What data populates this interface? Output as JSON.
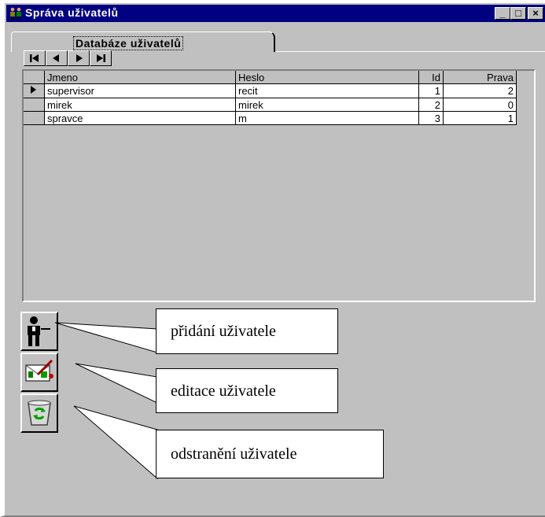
{
  "window": {
    "title": "Správa uživatelů",
    "controls": {
      "minimize": "_",
      "maximize": "□",
      "close": "×"
    }
  },
  "tab": {
    "label": "Databáze uživatelů"
  },
  "navigator": {
    "buttons": [
      "first-record-icon",
      "prior-record-icon",
      "next-record-icon",
      "last-record-icon"
    ]
  },
  "grid": {
    "columns": [
      "Jmeno",
      "Heslo",
      "Id",
      "Prava"
    ],
    "rows": [
      {
        "jmeno": "supervisor",
        "heslo": "recit",
        "id": "1",
        "prava": "2",
        "current": true
      },
      {
        "jmeno": "mirek",
        "heslo": "mirek",
        "id": "2",
        "prava": "0",
        "current": false
      },
      {
        "jmeno": "spravce",
        "heslo": "m",
        "id": "3",
        "prava": "1",
        "current": false
      }
    ]
  },
  "actions": {
    "add": {
      "icon": "add-user-icon",
      "callout": "přidání uživatele"
    },
    "edit": {
      "icon": "edit-user-icon",
      "callout": "editace uživatele"
    },
    "delete": {
      "icon": "recycle-bin-icon",
      "callout": "odstranění uživatele"
    }
  },
  "colors": {
    "titlebar": "#000080",
    "face": "#c0c0c0",
    "highlight": "#ffffff",
    "shadow": "#808080"
  }
}
